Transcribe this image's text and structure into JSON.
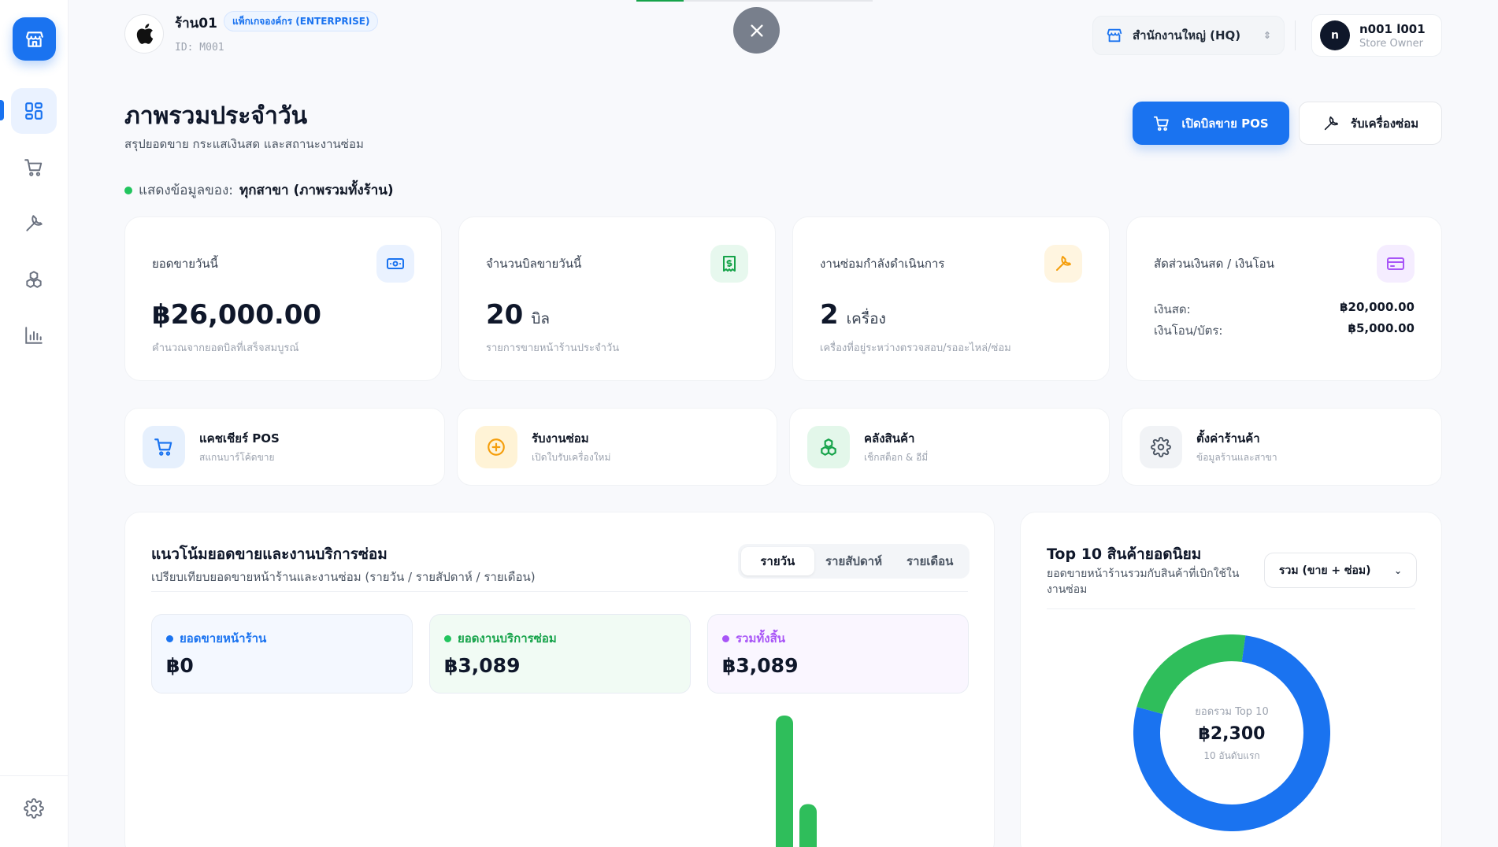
{
  "header": {
    "store_name": "ร้าน01",
    "plan_badge": "แพ็กเกจองค์กร (ENTERPRISE)",
    "store_id": "ID: M001",
    "branch": "สำนักงานใหญ่ (HQ)",
    "user_initial": "n",
    "user_name": "n001 l001",
    "user_role": "Store Owner"
  },
  "page": {
    "title": "ภาพรวมประจำวัน",
    "subtitle": "สรุปยอดขาย กระแสเงินสด และสถานะงานซ่อม",
    "open_pos_label": "เปิดบิลขาย POS",
    "repair_intake_label": "รับเครื่องซ่อม",
    "filter_label": "แสดงข้อมูลของ:",
    "filter_value": "ทุกสาขา (ภาพรวมทั้งร้าน)"
  },
  "stats": {
    "sales_today": {
      "title": "ยอดขายวันนี้",
      "value": "฿26,000.00",
      "desc": "คำนวณจากยอดบิลที่เสร็จสมบูรณ์"
    },
    "bills_today": {
      "title": "จำนวนบิลขายวันนี้",
      "value": "20",
      "unit": "บิล",
      "desc": "รายการขายหน้าร้านประจำวัน"
    },
    "repairs_in_progress": {
      "title": "งานซ่อมกำลังดำเนินการ",
      "value": "2",
      "unit": "เครื่อง",
      "desc": "เครื่องที่อยู่ระหว่างตรวจสอบ/รออะไหล่/ซ่อม"
    },
    "cash_ratio": {
      "title": "สัดส่วนเงินสด / เงินโอน",
      "cash_label": "เงินสด:",
      "cash_value": "฿20,000.00",
      "transfer_label": "เงินโอน/บัตร:",
      "transfer_value": "฿5,000.00"
    }
  },
  "quick_actions": [
    {
      "title": "แคชเชียร์ POS",
      "sub": "สแกนบาร์โค้ดขาย"
    },
    {
      "title": "รับงานซ่อม",
      "sub": "เปิดใบรับเครื่องใหม่"
    },
    {
      "title": "คลังสินค้า",
      "sub": "เช็กสต็อก & อีมี่"
    },
    {
      "title": "ตั้งค่าร้านค้า",
      "sub": "ข้อมูลร้านและสาขา"
    }
  ],
  "trend": {
    "title": "แนวโน้มยอดขายและงานบริการซ่อม",
    "subtitle": "เปรียบเทียบยอดขายหน้าร้านและงานซ่อม (รายวัน / รายสัปดาห์ / รายเดือน)",
    "tabs": [
      "รายวัน",
      "รายสัปดาห์",
      "รายเดือน"
    ],
    "active_tab": 0,
    "summary": [
      {
        "label": "ยอดขายหน้าร้าน",
        "value": "฿0",
        "color": "#1a73f0",
        "bg": "#f4f8ff"
      },
      {
        "label": "ยอดงานบริการซ่อม",
        "value": "฿3,089",
        "color": "#16a34a",
        "bg": "#f1fbf4"
      },
      {
        "label": "รวมทั้งสิ้น",
        "value": "฿3,089",
        "color": "#a855f7",
        "bg": "#faf6ff"
      }
    ]
  },
  "chart_data": {
    "type": "bar",
    "categories": [
      "",
      ""
    ],
    "series": [
      {
        "values": [
          0,
          0
        ],
        "color": "#1a73f0"
      },
      {
        "values": [
          3089,
          1450
        ],
        "color": "#2fbe5b"
      }
    ]
  },
  "top10": {
    "title": "Top 10 สินค้ายอดนิยม",
    "subtitle": "ยอดขายหน้าร้านรวมกับสินค้าที่เบิกใช้ในงานซ่อม",
    "select_value": "รวม (ขาย + ซ่อม)",
    "center_label": "ยอดรวม Top 10",
    "center_value": "฿2,300",
    "center_sub": "10 อันดับแรก",
    "segments": [
      {
        "share": 0.77,
        "color": "#1a73f0"
      },
      {
        "share": 0.23,
        "color": "#2fbe5b"
      }
    ]
  },
  "colors": {
    "accent": "#1a73f0",
    "success": "#22c55e"
  }
}
